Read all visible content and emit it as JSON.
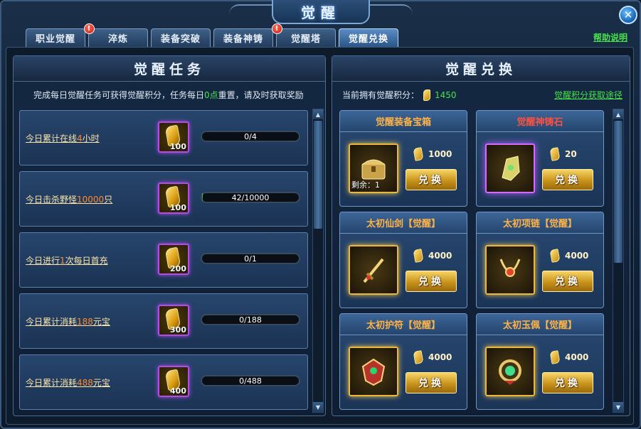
{
  "window": {
    "title": "觉醒"
  },
  "tabs": [
    {
      "label": "职业觉醒",
      "badge": ""
    },
    {
      "label": "淬炼",
      "badge": "!"
    },
    {
      "label": "装备突破",
      "badge": ""
    },
    {
      "label": "装备神铸",
      "badge": ""
    },
    {
      "label": "觉醒塔",
      "badge": "!"
    },
    {
      "label": "觉醒兑换",
      "badge": ""
    }
  ],
  "active_tab": "觉醒兑换",
  "help_link": "帮助说明",
  "tasks_panel": {
    "title": "觉醒任务",
    "subtitle_pre": "完成每日觉醒任务可获得觉醒积分，任务每日",
    "subtitle_hl": "0点",
    "subtitle_post": "重置，请及时获取奖励",
    "tasks": [
      {
        "pre": "今日累计在线",
        "hl": "4",
        "post": "小时",
        "reward": "100",
        "progress_text": "0/4",
        "progress": 0
      },
      {
        "pre": "今日击杀野怪",
        "hl": "10000",
        "post": "只",
        "reward": "100",
        "progress_text": "42/10000",
        "progress": 0.0042
      },
      {
        "pre": "今日进行",
        "hl": "1",
        "post": "次每日首充",
        "reward": "200",
        "progress_text": "0/1",
        "progress": 0
      },
      {
        "pre": "今日累计消耗",
        "hl": "188",
        "post": "元宝",
        "reward": "300",
        "progress_text": "0/188",
        "progress": 0
      },
      {
        "pre": "今日累计消耗",
        "hl": "488",
        "post": "元宝",
        "reward": "400",
        "progress_text": "0/488",
        "progress": 0
      }
    ]
  },
  "exchange_panel": {
    "title": "觉醒兑换",
    "points_label": "当前拥有觉醒积分：",
    "points_value": "1450",
    "points_link": "觉醒积分获取途径",
    "items": [
      {
        "name": "觉醒装备宝箱",
        "cost": "1000",
        "remaining": "剩余：1",
        "button": "兑换",
        "title_color": "orange",
        "icon": "treasure-chest-icon"
      },
      {
        "name": "觉醒神铸石",
        "cost": "20",
        "remaining": "",
        "button": "兑换",
        "title_color": "red",
        "icon": "cast-stone-icon"
      },
      {
        "name": "太初仙剑【觉醒】",
        "cost": "4000",
        "remaining": "",
        "button": "兑换",
        "title_color": "orange",
        "icon": "sword-icon"
      },
      {
        "name": "太初项链【觉醒】",
        "cost": "4000",
        "remaining": "",
        "button": "兑换",
        "title_color": "orange",
        "icon": "necklace-icon"
      },
      {
        "name": "太初护符【觉醒】",
        "cost": "4000",
        "remaining": "",
        "button": "兑换",
        "title_color": "orange",
        "icon": "amulet-icon"
      },
      {
        "name": "太初玉佩【觉醒】",
        "cost": "4000",
        "remaining": "",
        "button": "兑换",
        "title_color": "orange",
        "icon": "jade-pendant-icon"
      }
    ]
  }
}
